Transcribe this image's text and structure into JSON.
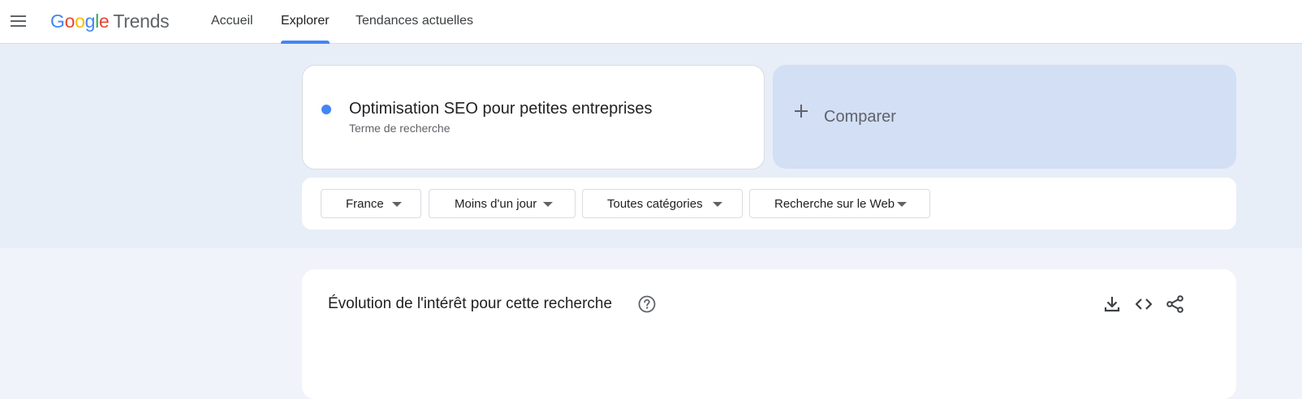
{
  "header": {
    "logo": {
      "google": "Google",
      "trends": "Trends"
    },
    "nav": [
      {
        "label": "Accueil",
        "active": false
      },
      {
        "label": "Explorer",
        "active": true
      },
      {
        "label": "Tendances actuelles",
        "active": false
      }
    ],
    "menu_icon": "hamburger-menu-icon"
  },
  "colors": {
    "accent": "#4285f4",
    "term_dot": "#4285f4",
    "compare_bg": "#d2dff5",
    "band_bg": "#e8eef8",
    "logo": [
      "#4285f4",
      "#ea4335",
      "#fbbc05",
      "#4285f4",
      "#34a853",
      "#ea4335"
    ]
  },
  "search": {
    "term": "Optimisation SEO pour petites entreprises",
    "term_type": "Terme de recherche",
    "compare_label": "Comparer"
  },
  "filters": [
    {
      "label": "France"
    },
    {
      "label": "Moins d'un jour"
    },
    {
      "label": "Toutes catégories"
    },
    {
      "label": "Recherche sur le Web"
    }
  ],
  "interest_card": {
    "title": "Évolution de l'intérêt pour cette recherche",
    "icons": [
      "help-icon",
      "download-icon",
      "embed-code-icon",
      "share-icon"
    ]
  }
}
